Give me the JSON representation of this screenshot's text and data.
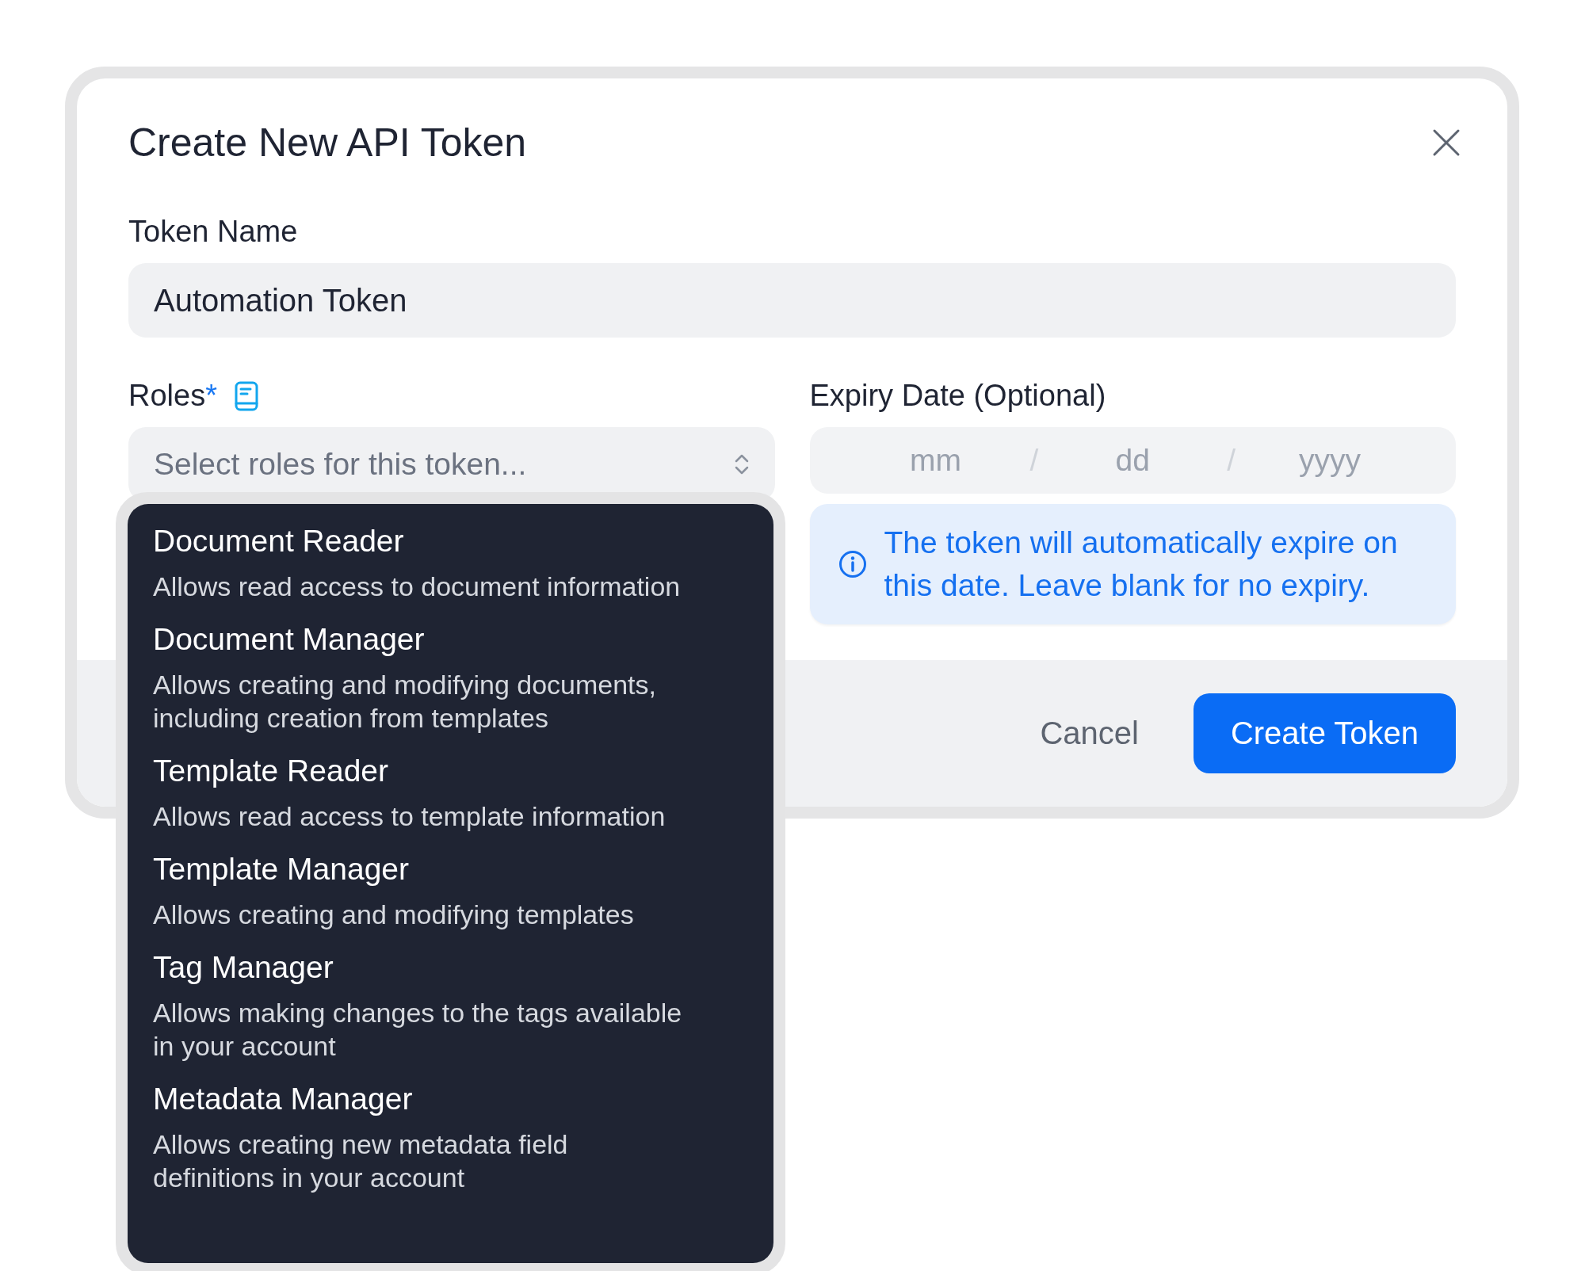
{
  "dialog": {
    "title": "Create New API Token"
  },
  "token_name": {
    "label": "Token Name",
    "value": "Automation Token"
  },
  "roles": {
    "label": "Roles",
    "required_mark": "*",
    "placeholder": "Select roles for this token...",
    "expanded": true,
    "options": [
      {
        "title": "Document Reader",
        "description": "Allows read access to document information"
      },
      {
        "title": "Document Manager",
        "description": "Allows creating and modifying documents, including creation from templates"
      },
      {
        "title": "Template Reader",
        "description": "Allows read access to template information"
      },
      {
        "title": "Template Manager",
        "description": "Allows creating and modifying templates"
      },
      {
        "title": "Tag Manager",
        "description": "Allows making changes to the tags available in your account"
      },
      {
        "title": "Metadata Manager",
        "description": "Allows creating new metadata field definitions in your account"
      }
    ]
  },
  "expiry": {
    "label": "Expiry Date (Optional)",
    "month_placeholder": "mm",
    "day_placeholder": "dd",
    "year_placeholder": "yyyy",
    "separators": [
      "/",
      "/"
    ],
    "info": "The token will automatically expire on this date. Leave blank for no expiry."
  },
  "footer": {
    "cancel": "Cancel",
    "submit": "Create Token"
  }
}
